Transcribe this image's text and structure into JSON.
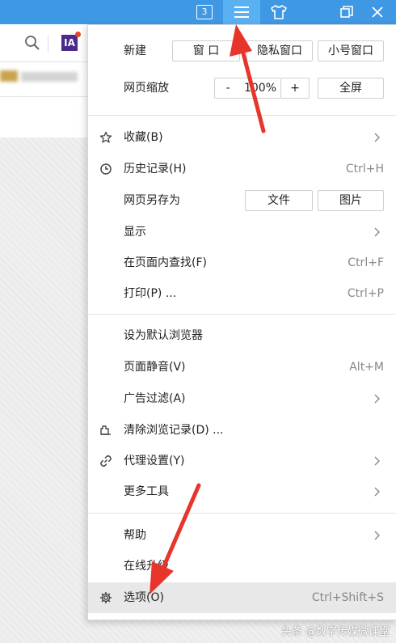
{
  "titlebar": {
    "tab_count": "3",
    "icons": [
      "tabs-count-icon",
      "menu-icon",
      "skin-icon",
      "restore-icon",
      "close-icon"
    ]
  },
  "toolbar": {
    "icons": [
      "search-icon",
      "extension-ia-icon"
    ],
    "ia_label": "IA"
  },
  "menu": {
    "new_label": "新建",
    "new_window_btn": "窗 口",
    "private_window_btn": "隐私窗口",
    "small_window_btn": "小号窗口",
    "zoom_label": "网页缩放",
    "zoom_minus": "-",
    "zoom_value": "100%",
    "zoom_plus": "+",
    "fullscreen_btn": "全屏",
    "favorites": "收藏(B)",
    "history": "历史记录(H)",
    "history_shortcut": "Ctrl+H",
    "save_as": "网页另存为",
    "save_file_btn": "文件",
    "save_image_btn": "图片",
    "display": "显示",
    "find": "在页面内查找(F)",
    "find_shortcut": "Ctrl+F",
    "print": "打印(P) ...",
    "print_shortcut": "Ctrl+P",
    "default_browser": "设为默认浏览器",
    "mute": "页面静音(V)",
    "mute_shortcut": "Alt+M",
    "ad_filter": "广告过滤(A)",
    "clear_history": "清除浏览记录(D) ...",
    "proxy": "代理设置(Y)",
    "more_tools": "更多工具",
    "help": "帮助",
    "upgrade": "在线升级",
    "options": "选项(O)",
    "options_shortcut": "Ctrl+Shift+S"
  },
  "watermark": "头条 @数字传媒微课堂",
  "colors": {
    "titlebar": "#3f98e3",
    "titlebar_active": "#5ab1f2",
    "arrow": "#e8352b",
    "highlight": "#e8e8e8"
  }
}
